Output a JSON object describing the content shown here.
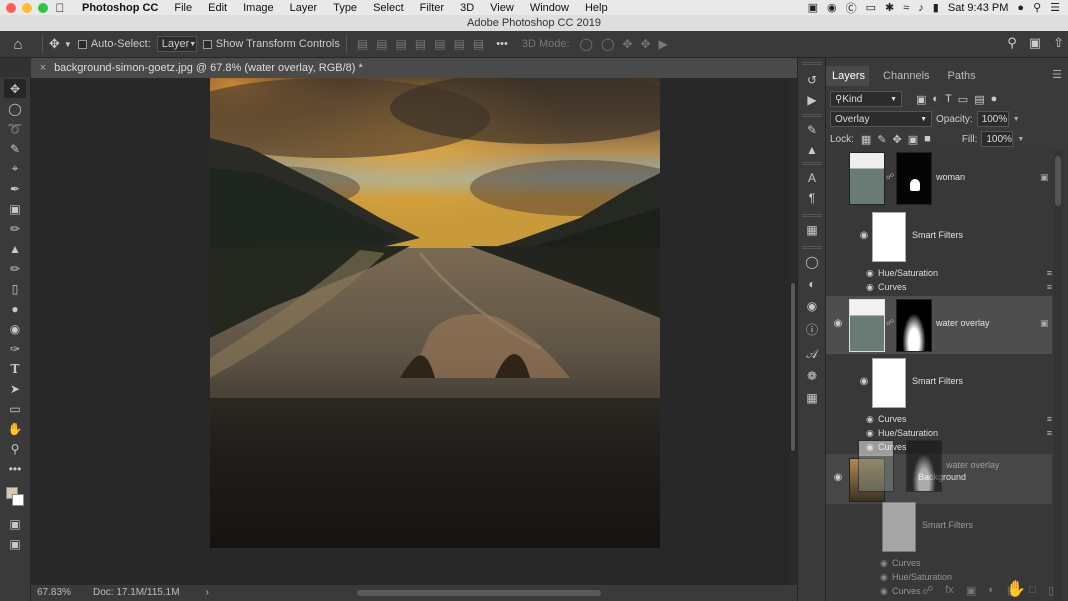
{
  "menubar": {
    "app_name": "Photoshop CC",
    "items": [
      "File",
      "Edit",
      "Image",
      "Layer",
      "Type",
      "Select",
      "Filter",
      "3D",
      "View",
      "Window",
      "Help"
    ],
    "clock": "Sat 9:43 PM"
  },
  "window": {
    "title": "Adobe Photoshop CC 2019"
  },
  "options_bar": {
    "auto_select_label": "Auto-Select:",
    "auto_select_target": "Layer",
    "transform_label": "Show Transform Controls",
    "mode_3d_label": "3D Mode:"
  },
  "document": {
    "tab_title": "background-simon-goetz.jpg @ 67.8% (water overlay, RGB/8) *"
  },
  "status": {
    "zoom": "67.83%",
    "doc_size": "Doc: 17.1M/115.1M"
  },
  "panel": {
    "tabs": [
      "Layers",
      "Channels",
      "Paths"
    ],
    "filter_kind": "Kind",
    "blend_mode": "Overlay",
    "opacity_label": "Opacity:",
    "opacity_value": "100%",
    "lock_label": "Lock:",
    "fill_label": "Fill:",
    "fill_value": "100%"
  },
  "layers": {
    "woman": {
      "name": "woman",
      "smart_filters": "Smart Filters",
      "filters": [
        "Hue/Saturation",
        "Curves"
      ]
    },
    "water": {
      "name": "water overlay",
      "smart_filters": "Smart Filters",
      "filters": [
        "Curves",
        "Hue/Saturation",
        "Curves"
      ]
    },
    "background": {
      "name": "Background"
    },
    "ghost": {
      "name": "water overlay",
      "smart_filters": "Smart Filters",
      "filters": [
        "Curves",
        "Hue/Saturation",
        "Curves"
      ]
    }
  },
  "colors": {
    "foreground": "#d9c8a8",
    "background": "#ffffff",
    "selected_layer": "#4e4e4e"
  }
}
